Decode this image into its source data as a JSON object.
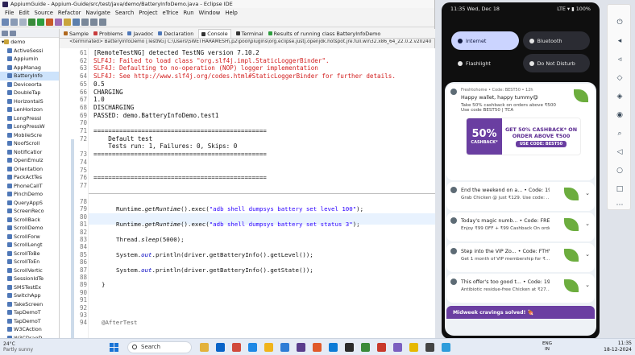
{
  "window": {
    "title": "AppiumGuide - Appium-Guide/src/test/java/demo/BatteryInfoDemo.java - Eclipse IDE"
  },
  "menu": [
    "File",
    "Edit",
    "Source",
    "Refactor",
    "Navigate",
    "Search",
    "Project",
    "eTrice",
    "Run",
    "Window",
    "Help"
  ],
  "package_explorer": {
    "root": "demo",
    "items": [
      "ActiveSessi",
      "Appiumin",
      "AppManag",
      "BatteryInfo",
      "Deviceorta",
      "DoubleTap",
      "HorizontalS",
      "LenHorizon",
      "LongPressI",
      "LongPressW",
      "MobileScre",
      "NoofScroll",
      "Notificatior",
      "OpenEmulz",
      "Orientation",
      "PackActTes",
      "PhoneCallT",
      "PinchDemo",
      "QueryAppS",
      "ScreenReco",
      "ScrollBack",
      "ScrollDemo",
      "ScrollForw",
      "ScrollLengt",
      "ScrollToBe",
      "ScrollToEn",
      "ScrollVertic",
      "SessionIdTe",
      "SMSTestEx",
      "SwitchApp",
      "TakeScreen",
      "TapDemoT",
      "TapDemoT",
      "W3CAction",
      "W3CDragD"
    ],
    "selected_index": 3
  },
  "view_tabs": [
    "Sample",
    "Problems",
    "Javadoc",
    "Declaration",
    "Console",
    "Terminal",
    "Results of running class BatteryInfoDemo"
  ],
  "active_view_tab": "Console",
  "console_header": "<terminated> BatteryInfoDemo [TestNG] C:\\Users\\SWETHARAMESH\\.p2\\pool\\plugins\\org.eclipse.justj.openjdk.hotspot.jre.full.win32.x86_64_22.0.2.v20240",
  "code_lines": [
    {
      "ln": "61",
      "text": "[RemoteTestNG] detected TestNG version 7.10.2",
      "style": "plain"
    },
    {
      "ln": "62",
      "text": "SLF4J: Failed to load class \"org.slf4j.impl.StaticLoggerBinder\".",
      "style": "err"
    },
    {
      "ln": "63",
      "text": "SLF4J: Defaulting to no-operation (NOP) logger implementation",
      "style": "err"
    },
    {
      "ln": "64",
      "text": "SLF4J: See http://www.slf4j.org/codes.html#StaticLoggerBinder for further details.",
      "style": "err"
    },
    {
      "ln": "65",
      "text": "0.5",
      "style": "plain"
    },
    {
      "ln": "66",
      "text": "CHARGING",
      "style": "plain"
    },
    {
      "ln": "67",
      "text": "1.0",
      "style": "plain"
    },
    {
      "ln": "68",
      "text": "DISCHARGING",
      "style": "plain"
    },
    {
      "ln": "69",
      "text": "PASSED: demo.BatteryInfoDemo.test1",
      "style": "plain"
    },
    {
      "ln": "70",
      "text": "",
      "style": "plain"
    },
    {
      "ln": "71",
      "text": "===============================================",
      "style": "plain"
    },
    {
      "ln": "72",
      "text": "    Default test",
      "style": "plain"
    },
    {
      "ln": "",
      "text": "    Tests run: 1, Failures: 0, Skips: 0",
      "style": "plain"
    },
    {
      "ln": "73",
      "text": "===============================================",
      "style": "plain"
    },
    {
      "ln": "74",
      "text": "",
      "style": "plain"
    },
    {
      "ln": "75",
      "text": "",
      "style": "plain"
    },
    {
      "ln": "76",
      "text": "===============================================",
      "style": "plain"
    },
    {
      "ln": "77",
      "text": "",
      "style": "plain"
    }
  ],
  "source_lines": [
    {
      "ln": "78",
      "code": ""
    },
    {
      "ln": "79",
      "code": "Runtime.getRuntime().exec(\"adb shell dumpsys battery set level 100\");"
    },
    {
      "ln": "80",
      "code": ""
    },
    {
      "ln": "81",
      "code": "Runtime.getRuntime().exec(\"adb shell dumpsys battery set status 3\");"
    },
    {
      "ln": "82",
      "code": ""
    },
    {
      "ln": "83",
      "code": "Thread.sleep(5000);"
    },
    {
      "ln": "84",
      "code": ""
    },
    {
      "ln": "85",
      "code": "System.out.println(driver.getBatteryInfo().getLevel());"
    },
    {
      "ln": "86",
      "code": ""
    },
    {
      "ln": "87",
      "code": "System.out.println(driver.getBatteryInfo().getState());"
    },
    {
      "ln": "88",
      "code": ""
    },
    {
      "ln": "89",
      "code": "}"
    },
    {
      "ln": "90",
      "code": ""
    },
    {
      "ln": "91",
      "code": ""
    },
    {
      "ln": "92",
      "code": ""
    },
    {
      "ln": "93",
      "code": ""
    },
    {
      "ln": "94",
      "code": "@AfterTest"
    }
  ],
  "phone": {
    "time": "11:35 Wed, Dec 18",
    "network": "LTE",
    "battery": "100%",
    "tiles": [
      {
        "label": "Internet",
        "state": "on"
      },
      {
        "label": "Bluetooth",
        "state": "off"
      },
      {
        "label": "Flashlight",
        "state": "off"
      },
      {
        "label": "Do Not Disturb",
        "state": "off"
      }
    ],
    "notifications": [
      {
        "meta": "Freshtohome • Code: BEST50 • 12h",
        "title": "Happy wallet, happy tummy😋",
        "body": "Take 50% cashback on orders above ₹500 Use code BEST50 | TCA"
      },
      {
        "meta": "",
        "title": "End the weekend on a... • Code: 1990 • 2d",
        "body": "Grab Chicken @ just ₹129. Use code: ..."
      },
      {
        "meta": "",
        "title": "Today's magic numb... • Code: FRE200 • 2d",
        "body": "Enjoy ₹99 OFF + ₹99 Cashback On orde..."
      },
      {
        "meta": "",
        "title": "Step into the VIP Zo... • Code: FTHV... • 2d",
        "body": "Get 1 month of VIP membership for ₹..."
      },
      {
        "meta": "",
        "title": "This offer's too good t... • Code: 1990 • 2d",
        "body": "Antibiotic residue-free Chicken at ₹27..."
      }
    ],
    "banner": {
      "percent": "50%",
      "percent_sub": "CASHBACK*",
      "headline": "GET 50% CASHBACK* ON ORDER ABOVE ₹500",
      "code": "USE CODE: BEST50"
    },
    "promo": "Midweek cravings solved! 🍖"
  },
  "taskbar": {
    "weather_temp": "24°C",
    "weather_desc": "Partly sunny",
    "search": "Search",
    "lang": "ENG",
    "lang2": "IN",
    "time": "11:35",
    "date": "18-12-2024"
  },
  "colors": {
    "accent": "#1873d6",
    "error": "#d21e1e",
    "keyword": "#7f0055",
    "string": "#2a00ff",
    "field": "#0000c0",
    "brand": "#6a3ea1"
  }
}
